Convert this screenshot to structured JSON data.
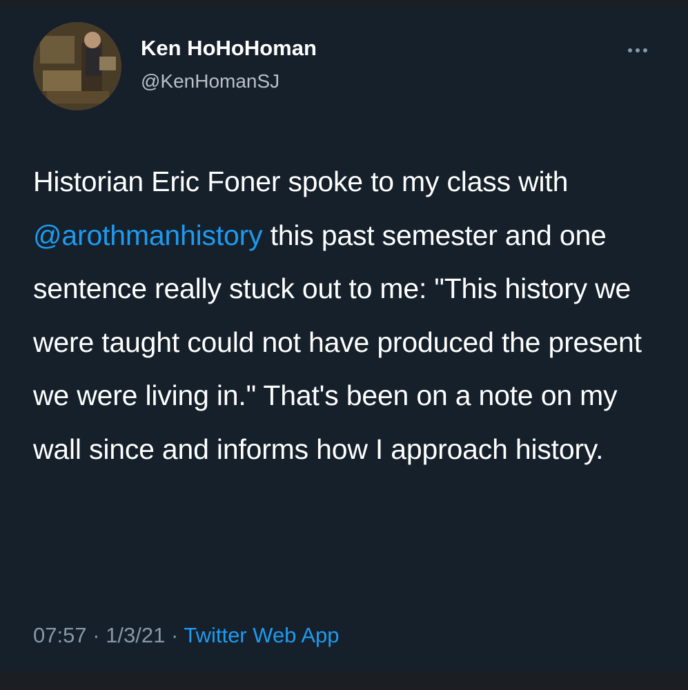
{
  "tweet": {
    "author": {
      "display_name": "Ken HoHoHoman",
      "handle": "@KenHomanSJ"
    },
    "more_icon": "more-horizontal-icon",
    "text": {
      "part1": "Historian Eric Foner spoke to my class with ",
      "mention": "@arothmanhistory",
      "part2": " this past semester and one sentence really stuck out to me: \"This history we were taught could not have produced the present we were living in.\" That's been on a note on my wall since and informs how I approach history."
    },
    "meta": {
      "time": "07:57",
      "separator": " · ",
      "date": "1/3/21",
      "source": "Twitter Web App"
    }
  },
  "colors": {
    "background": "#15202b",
    "text": "#ffffff",
    "secondary": "#8899a6",
    "link": "#1d9bf0"
  }
}
